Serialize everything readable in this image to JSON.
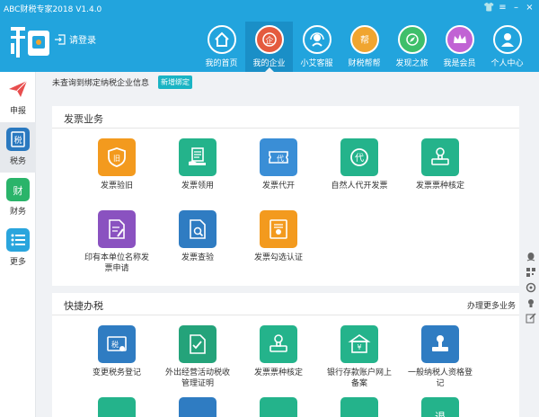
{
  "app": {
    "title": "ABC财税专家2018 V1.4.0"
  },
  "header": {
    "login_label": "请登录",
    "nav": [
      {
        "label": "我的首页",
        "icon": "home-icon",
        "color": "#2cc4c0"
      },
      {
        "label": "我的企业",
        "icon": "company-icon",
        "color": "#e45b3f"
      },
      {
        "label": "小艾客服",
        "icon": "headset-icon",
        "color": "#2cc4c0"
      },
      {
        "label": "财税帮帮",
        "icon": "help-icon",
        "color": "#f0a530"
      },
      {
        "label": "发现之旅",
        "icon": "compass-icon",
        "color": "#3fbf6b"
      },
      {
        "label": "我是会员",
        "icon": "crown-icon",
        "color": "#c163d4"
      },
      {
        "label": "个人中心",
        "icon": "user-icon",
        "color": "#2cc4c0"
      }
    ]
  },
  "sidebar": {
    "items": [
      {
        "label": "申报",
        "icon": "paper-plane-icon",
        "color": "#e84e4e"
      },
      {
        "label": "税务",
        "icon": "tax-icon",
        "color": "#2a79c0"
      },
      {
        "label": "财务",
        "icon": "finance-icon",
        "color": "#2ab46a"
      },
      {
        "label": "更多",
        "icon": "list-icon",
        "color": "#2aa5dd"
      }
    ]
  },
  "notice": {
    "text": "未查询到绑定纳税企业信息",
    "button": "新增绑定"
  },
  "invoice_panel": {
    "title": "发票业务",
    "tiles": [
      {
        "label": "发票验旧",
        "icon": "invoice-check-icon",
        "color": "#f39a1e"
      },
      {
        "label": "发票领用",
        "icon": "invoice-receive-icon",
        "color": "#24b38b"
      },
      {
        "label": "发票代开",
        "icon": "invoice-proxy-icon",
        "color": "#3a8ed6"
      },
      {
        "label": "自然人代开发票",
        "icon": "proxy-icon",
        "color": "#24b38b"
      },
      {
        "label": "发票票种核定",
        "icon": "stamp-icon",
        "color": "#24b38b"
      },
      {
        "label": "印有本单位名称发票申请",
        "icon": "apply-icon",
        "color": "#8a52c0"
      },
      {
        "label": "发票查验",
        "icon": "invoice-search-icon",
        "color": "#2f7cc2"
      },
      {
        "label": "发票勾选认证",
        "icon": "certify-icon",
        "color": "#f39a1e"
      }
    ]
  },
  "quick_panel": {
    "title": "快捷办税",
    "more": "办理更多业务",
    "tiles": [
      {
        "label": "变更税务登记",
        "icon": "tax-change-icon",
        "color": "#2f7cc2"
      },
      {
        "label": "外出经营活动税收管理证明",
        "icon": "certificate-icon",
        "color": "#24a37a"
      },
      {
        "label": "发票票种核定",
        "icon": "stamp-icon",
        "color": "#24b38b"
      },
      {
        "label": "银行存款账户网上备案",
        "icon": "bank-icon",
        "color": "#24b38b"
      },
      {
        "label": "一般纳税人资格登记",
        "icon": "seal-icon",
        "color": "#2f7cc2"
      },
      {
        "label": "",
        "icon": "doc-icon",
        "color": "#24b38b"
      },
      {
        "label": "",
        "icon": "doc-icon",
        "color": "#2f7cc2"
      },
      {
        "label": "",
        "icon": "money-icon",
        "color": "#24b38b"
      },
      {
        "label": "",
        "icon": "doc-icon",
        "color": "#24b38b"
      },
      {
        "label": "退",
        "icon": "refund-icon",
        "color": "#24b38b"
      }
    ]
  },
  "tools": [
    "qq-icon",
    "qrcode-icon",
    "settings-icon",
    "bulb-icon",
    "edit-icon"
  ]
}
